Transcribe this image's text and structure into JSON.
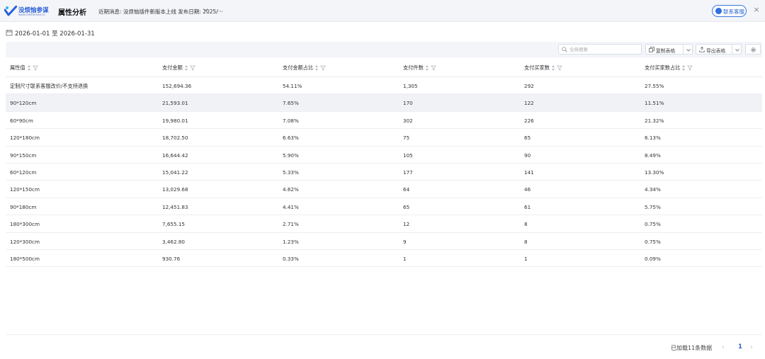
{
  "header": {
    "logo_text": "没烦恼参谋",
    "logo_sub": "www.meifannao.cn",
    "title": "属性分析",
    "news": "近期消息: 没烦恼插件新版本上线 发布日期: 2025/···",
    "contact_label": "联系客服",
    "accent_color": "#2a63cf"
  },
  "date_range": "2026-01-01 至 2026-01-31",
  "toolbar": {
    "search_placeholder": "全局搜索",
    "copy_label": "复制表格",
    "export_label": "导出表格"
  },
  "table": {
    "columns": [
      "属性值",
      "支付金额",
      "支付金额占比",
      "支付件数",
      "支付买家数",
      "支付买家数占比"
    ],
    "rows": [
      [
        "定制尺寸联系客服改价/不支持退换",
        "152,694.36",
        "54.11%",
        "1,305",
        "292",
        "27.55%"
      ],
      [
        "90*120cm",
        "21,593.01",
        "7.65%",
        "170",
        "122",
        "11.51%"
      ],
      [
        "60*90cm",
        "19,980.01",
        "7.08%",
        "302",
        "226",
        "21.32%"
      ],
      [
        "120*180cm",
        "18,702.50",
        "6.63%",
        "75",
        "65",
        "6.13%"
      ],
      [
        "90*150cm",
        "16,644.42",
        "5.90%",
        "105",
        "90",
        "8.49%"
      ],
      [
        "60*120cm",
        "15,041.22",
        "5.33%",
        "177",
        "141",
        "13.30%"
      ],
      [
        "120*150cm",
        "13,029.68",
        "4.62%",
        "64",
        "46",
        "4.34%"
      ],
      [
        "90*180cm",
        "12,451.83",
        "4.41%",
        "65",
        "61",
        "5.75%"
      ],
      [
        "180*300cm",
        "7,655.15",
        "2.71%",
        "12",
        "8",
        "0.75%"
      ],
      [
        "120*300cm",
        "3,462.80",
        "1.23%",
        "9",
        "8",
        "0.75%"
      ],
      [
        "180*500cm",
        "930.76",
        "0.33%",
        "1",
        "1",
        "0.09%"
      ]
    ]
  },
  "footer": {
    "load_info": "已加载11条数据",
    "current_page": "1"
  }
}
